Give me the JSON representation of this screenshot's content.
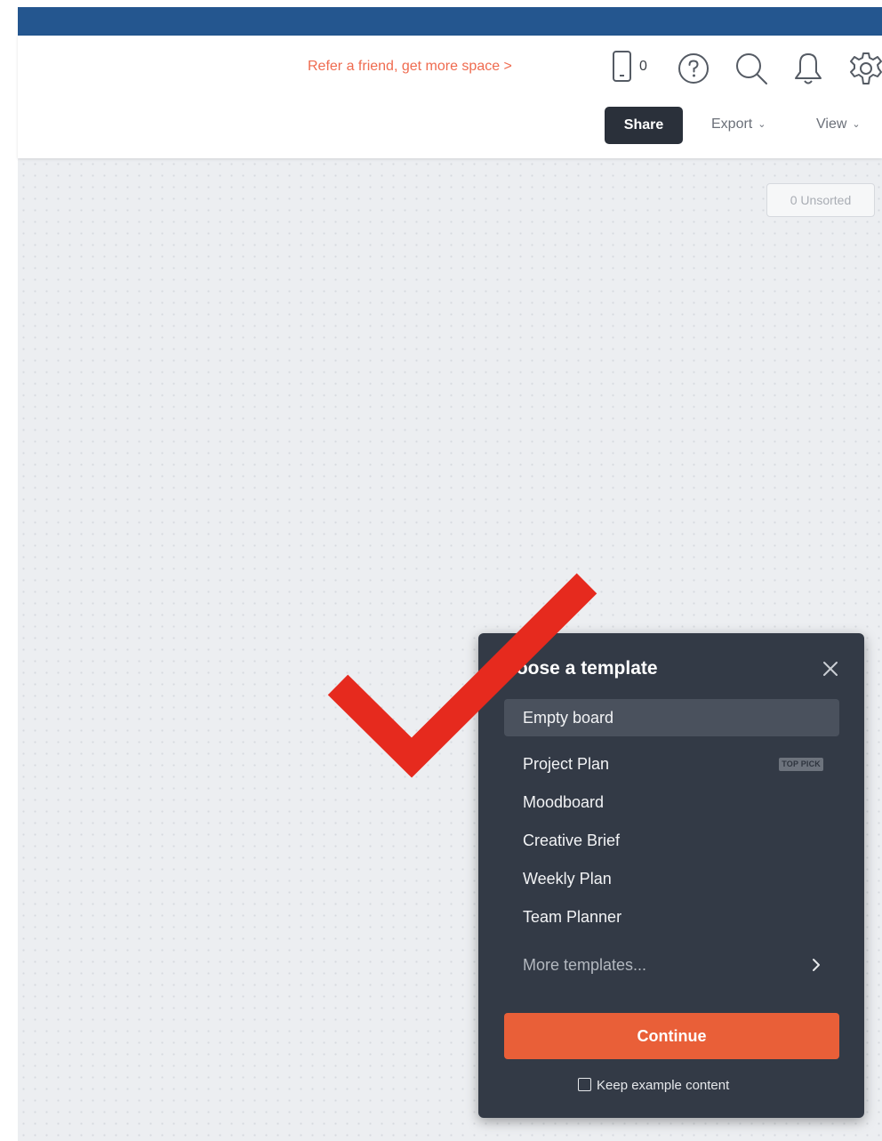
{
  "header": {
    "refer_link": "Refer a friend, get more space >",
    "device_count": "0",
    "icons": {
      "device": "device-icon",
      "help": "help-icon",
      "search": "search-icon",
      "notifications": "bell-icon",
      "settings": "gear-icon"
    },
    "share_label": "Share",
    "export_label": "Export",
    "view_label": "View"
  },
  "canvas": {
    "unsorted_label": "0 Unsorted"
  },
  "template_panel": {
    "title": "hoose a template",
    "items": [
      {
        "label": "Empty board",
        "selected": true
      },
      {
        "label": "Project Plan",
        "badge": "TOP PICK"
      },
      {
        "label": "Moodboard"
      },
      {
        "label": "Creative Brief"
      },
      {
        "label": "Weekly Plan"
      },
      {
        "label": "Team Planner"
      }
    ],
    "more_label": "More templates...",
    "continue_label": "Continue",
    "keep_example_label": "Keep example content",
    "keep_example_checked": false
  },
  "colors": {
    "top_bar": "#24568f",
    "refer_link": "#ef6b4f",
    "share_button": "#2a303a",
    "canvas_bg": "#eceef1",
    "panel_bg": "#333a46",
    "selected_item_bg": "#4a515d",
    "continue_button": "#e95f38",
    "checkmark": "#e62a1e"
  },
  "overlay": {
    "icon": "checkmark-icon"
  }
}
